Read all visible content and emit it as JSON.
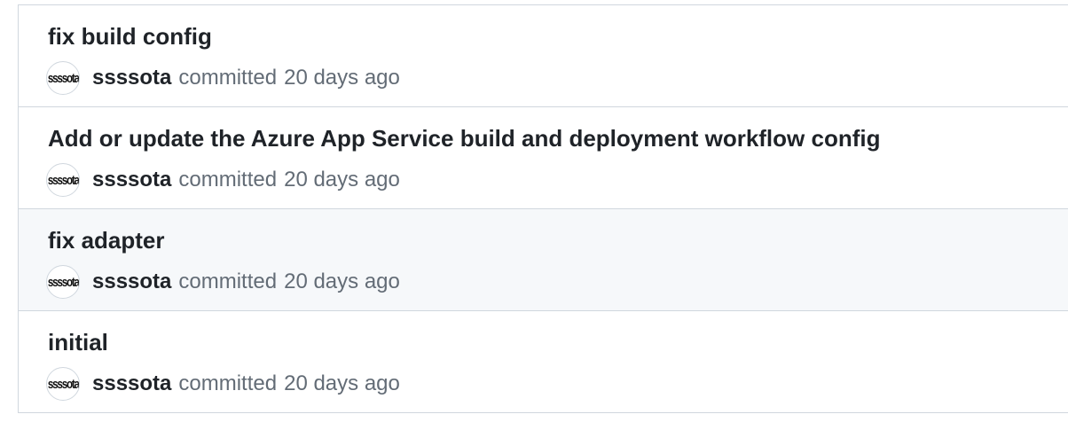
{
  "commits": [
    {
      "title": "fix build config",
      "author": "ssssota",
      "avatar_text": "ssssota",
      "action": "committed",
      "time": "20 days ago"
    },
    {
      "title": "Add or update the Azure App Service build and deployment workflow config",
      "author": "ssssota",
      "avatar_text": "ssssota",
      "action": "committed",
      "time": "20 days ago"
    },
    {
      "title": "fix adapter",
      "author": "ssssota",
      "avatar_text": "ssssota",
      "action": "committed",
      "time": "20 days ago",
      "highlighted": true
    },
    {
      "title": "initial",
      "author": "ssssota",
      "avatar_text": "ssssota",
      "action": "committed",
      "time": "20 days ago"
    }
  ],
  "colors": {
    "border": "#d0d7de",
    "text_primary": "#1f2328",
    "text_muted": "#636c76",
    "row_highlight": "#f6f8fa"
  }
}
